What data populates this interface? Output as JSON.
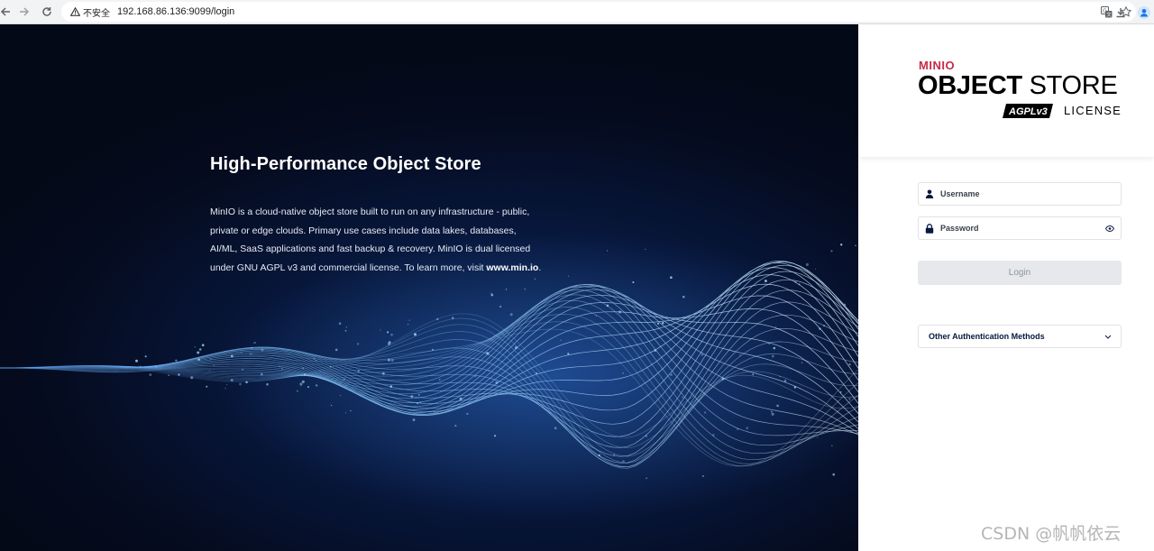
{
  "browser": {
    "back_icon": "arrow-left-icon",
    "forward_icon": "arrow-right-icon",
    "reload_icon": "reload-icon",
    "security_label": "不安全",
    "url": "192.168.86.136:9099/login",
    "translate_icon": "translate-icon",
    "bookmark_icon": "star-icon",
    "download_icon": "download-icon",
    "profile_icon": "profile-icon"
  },
  "hero": {
    "title": "High-Performance Object Store",
    "description": "MinIO is a cloud-native object store built to run on any infrastructure - public, private or edge clouds. Primary use cases include data lakes, databases, AI/ML, SaaS applications and fast backup & recovery. MinIO is dual licensed under GNU AGPL v3 and commercial license. To learn more, visit ",
    "link_text": "www.min.io",
    "description_end": "."
  },
  "brand": {
    "minio": "MINIO",
    "object": "OBJECT",
    "store": "STORE",
    "agpl": "AGPLv3",
    "license": "LICENSE",
    "accent_color": "#c72c48"
  },
  "form": {
    "username_placeholder": "Username",
    "password_placeholder": "Password",
    "login_label": "Login",
    "other_auth_label": "Other Authentication Methods"
  },
  "watermark": "CSDN @帆帆依云"
}
